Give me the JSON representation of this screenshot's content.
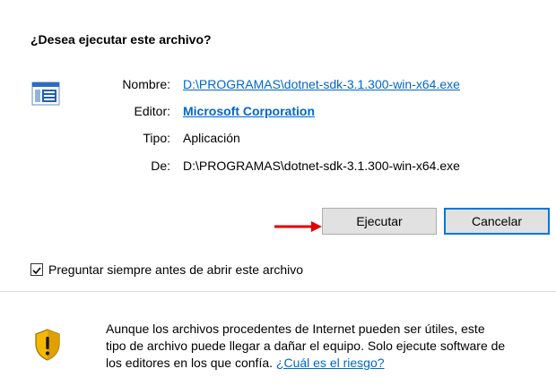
{
  "dialog": {
    "title": "¿Desea ejecutar este archivo?",
    "icon": "exe-file-icon"
  },
  "info": {
    "name_label": "Nombre:",
    "name_value": "D:\\PROGRAMAS\\dotnet-sdk-3.1.300-win-x64.exe",
    "publisher_label": "Editor:",
    "publisher_value": "Microsoft Corporation",
    "type_label": "Tipo:",
    "type_value": "Aplicación",
    "from_label": "De:",
    "from_value": "D:\\PROGRAMAS\\dotnet-sdk-3.1.300-win-x64.exe"
  },
  "buttons": {
    "run_label": "Ejecutar",
    "cancel_label": "Cancelar"
  },
  "checkbox": {
    "label": "Preguntar siempre antes de abrir este archivo",
    "checked": true
  },
  "warning": {
    "icon": "shield-warning-icon",
    "line1": "Aunque los archivos procedentes de Internet pueden ser útiles, este",
    "line2": "tipo de archivo puede llegar a dañar el equipo. Solo ejecute software de",
    "line3_prefix": "los editores en los que confía. ",
    "risk_link": "¿Cuál es el riesgo?"
  },
  "colors": {
    "link": "#0066cc",
    "arrow": "#e00000",
    "cancel_border": "#0078d7"
  }
}
